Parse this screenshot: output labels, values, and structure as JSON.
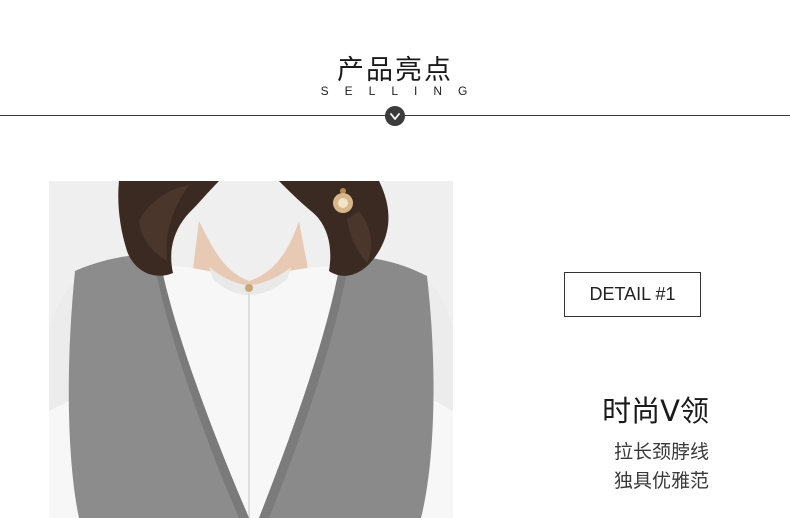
{
  "header": {
    "title": "产品亮点",
    "subtitle": "SELLING",
    "badge_icon": "chevron-down-icon"
  },
  "detail": {
    "tag": "DETAIL #1",
    "feature_title": "时尚V领",
    "feature_lines": [
      "拉长颈脖线",
      "独具优雅范"
    ]
  },
  "colors": {
    "text": "#222222",
    "divider": "#3a3a3a",
    "badge": "#3b3b3b",
    "vest_gray": "#8c8c8c",
    "shirt_white": "#f7f7f7",
    "background": "#ffffff"
  }
}
